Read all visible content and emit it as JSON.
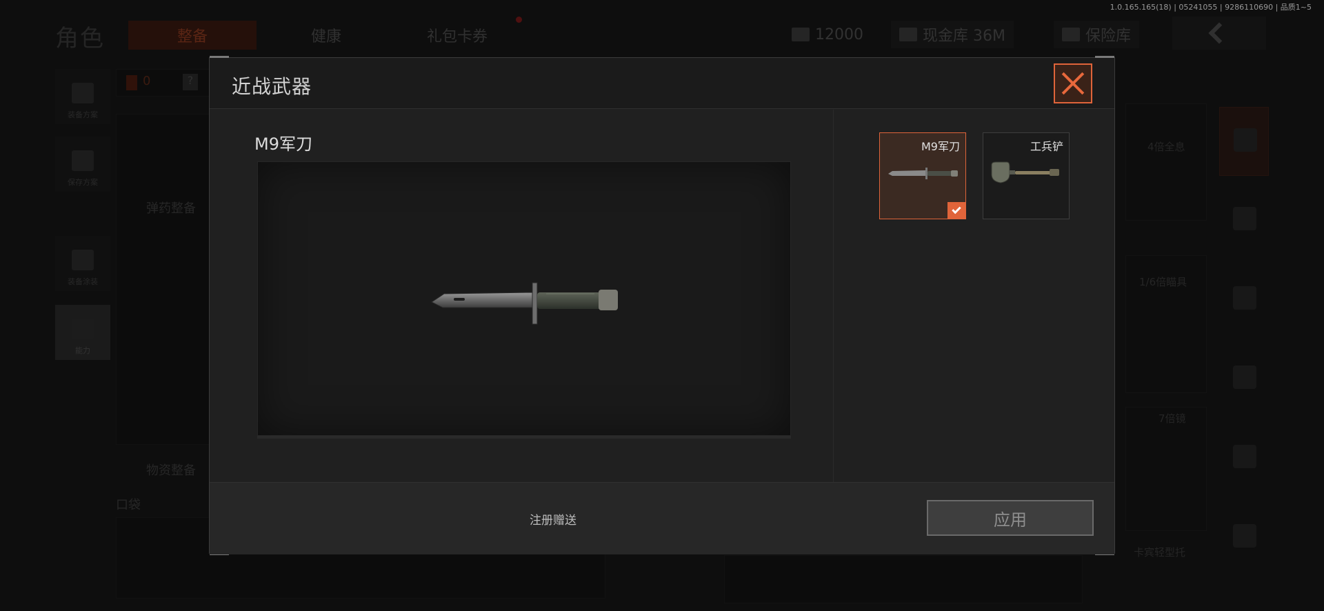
{
  "version_info": "1.0.165.165(18) | 05241055 | 9286110690 | 品质1~5",
  "background": {
    "title": "角色",
    "tabs": [
      {
        "label": "整备"
      },
      {
        "label": "健康"
      },
      {
        "label": "礼包卡券"
      }
    ],
    "currency": "12000",
    "cash_vault": "现金库 36M",
    "safe_box": "保险库",
    "side_buttons": [
      {
        "label": "装备方案"
      },
      {
        "label": "保存方案"
      },
      {
        "label": "装备涂装"
      },
      {
        "label": "能力"
      }
    ],
    "left_labels": {
      "counter": "0",
      "ammo_sort": "弹药整备",
      "supply_sort": "物资整备",
      "pocket": "口袋"
    },
    "right_labels": {
      "scope_4x": "4倍全息",
      "scope_16x": "1/6倍瞄具",
      "scope_7x": "7倍镜",
      "carbine": "卡宾轻型托"
    }
  },
  "modal": {
    "title": "近战武器",
    "selected_item_name": "M9军刀",
    "weapons": [
      {
        "name": "M9军刀",
        "selected": true,
        "icon": "bayonet-knife-icon"
      },
      {
        "name": "工兵铲",
        "selected": false,
        "icon": "entrenching-shovel-icon"
      }
    ],
    "source_text": "注册赠送",
    "apply_label": "应用",
    "accent_color": "#e0643a"
  }
}
